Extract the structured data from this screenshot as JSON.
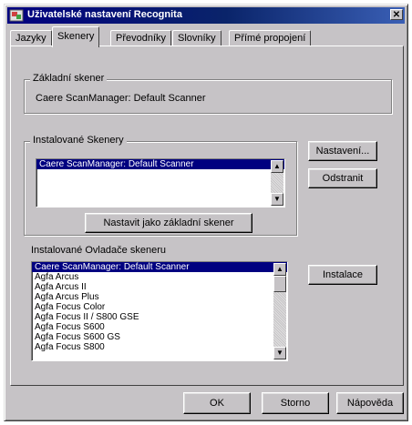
{
  "window": {
    "title": "Uživatelské nastavení Recognita"
  },
  "tabs": [
    {
      "label": "Jazyky"
    },
    {
      "label": "Skenery"
    },
    {
      "label": "Převodníky"
    },
    {
      "label": "Slovníky"
    },
    {
      "label": "Přímé propojení"
    }
  ],
  "default_scanner": {
    "label": "Základní skener",
    "value": "Caere ScanManager: Default Scanner"
  },
  "installed_scanners": {
    "label": "Instalované Skenery",
    "items": [
      "Caere ScanManager: Default Scanner"
    ],
    "selected_index": 0,
    "set_default_button": "Nastavit jako základní skener"
  },
  "side_buttons": {
    "settings": "Nastavení...",
    "remove": "Odstranit",
    "install": "Instalace"
  },
  "installed_drivers": {
    "label": "Instalované Ovladače skeneru",
    "items": [
      "Caere ScanManager: Default Scanner",
      "Agfa Arcus",
      "Agfa Arcus II",
      "Agfa Arcus Plus",
      "Agfa Focus Color",
      "Agfa Focus II / S800 GSE",
      "Agfa Focus S600",
      "Agfa Focus S600 GS",
      "Agfa Focus S800"
    ],
    "selected_index": 0
  },
  "footer": {
    "ok": "OK",
    "cancel": "Storno",
    "help": "Nápověda"
  }
}
